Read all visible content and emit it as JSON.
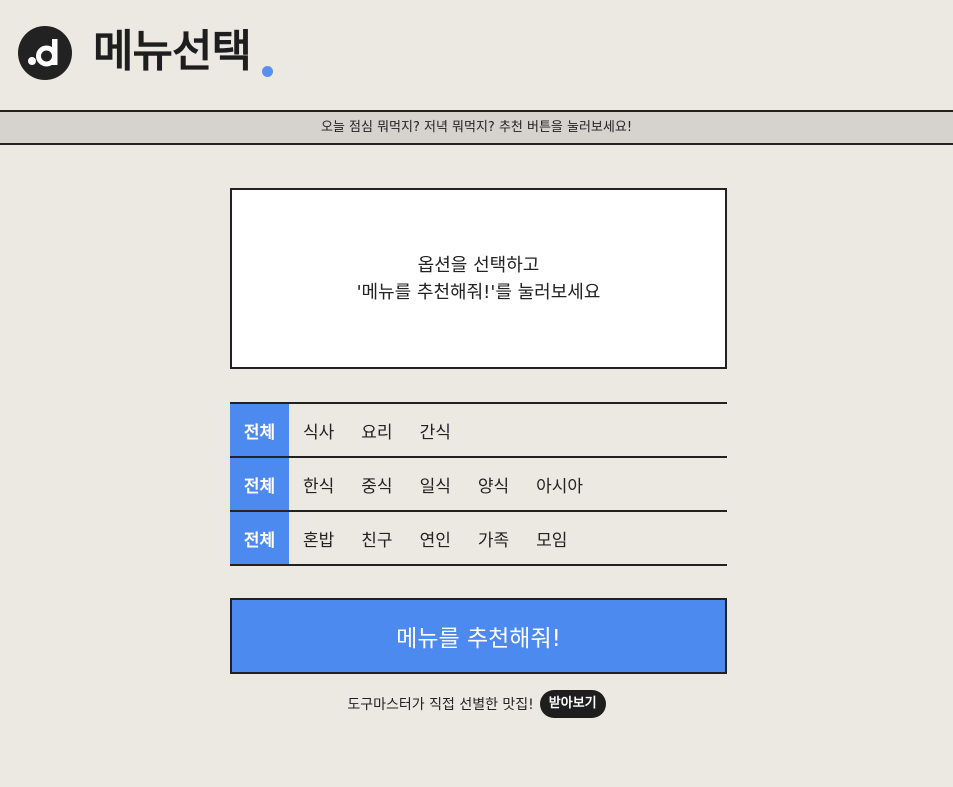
{
  "header": {
    "logo_icon": "d-logo-icon",
    "title": "메뉴선택",
    "accent_color": "#5a8ef0"
  },
  "banner": {
    "text": "오늘 점심 뭐먹지? 저녁 뭐먹지? 추천 버튼을 눌러보세요!"
  },
  "result": {
    "line1": "옵션을 선택하고",
    "line2": "'메뉴를 추천해줘!'를 눌러보세요"
  },
  "filters": [
    {
      "all_label": "전체",
      "options": [
        "식사",
        "요리",
        "간식"
      ]
    },
    {
      "all_label": "전체",
      "options": [
        "한식",
        "중식",
        "일식",
        "양식",
        "아시아"
      ]
    },
    {
      "all_label": "전체",
      "options": [
        "혼밥",
        "친구",
        "연인",
        "가족",
        "모임"
      ]
    }
  ],
  "recommend_button": {
    "label": "메뉴를 추천해줘!",
    "color": "#4d8af0"
  },
  "footer": {
    "text": "도구마스터가 직접 선별한 맛집!",
    "pill_label": "받아보기"
  }
}
